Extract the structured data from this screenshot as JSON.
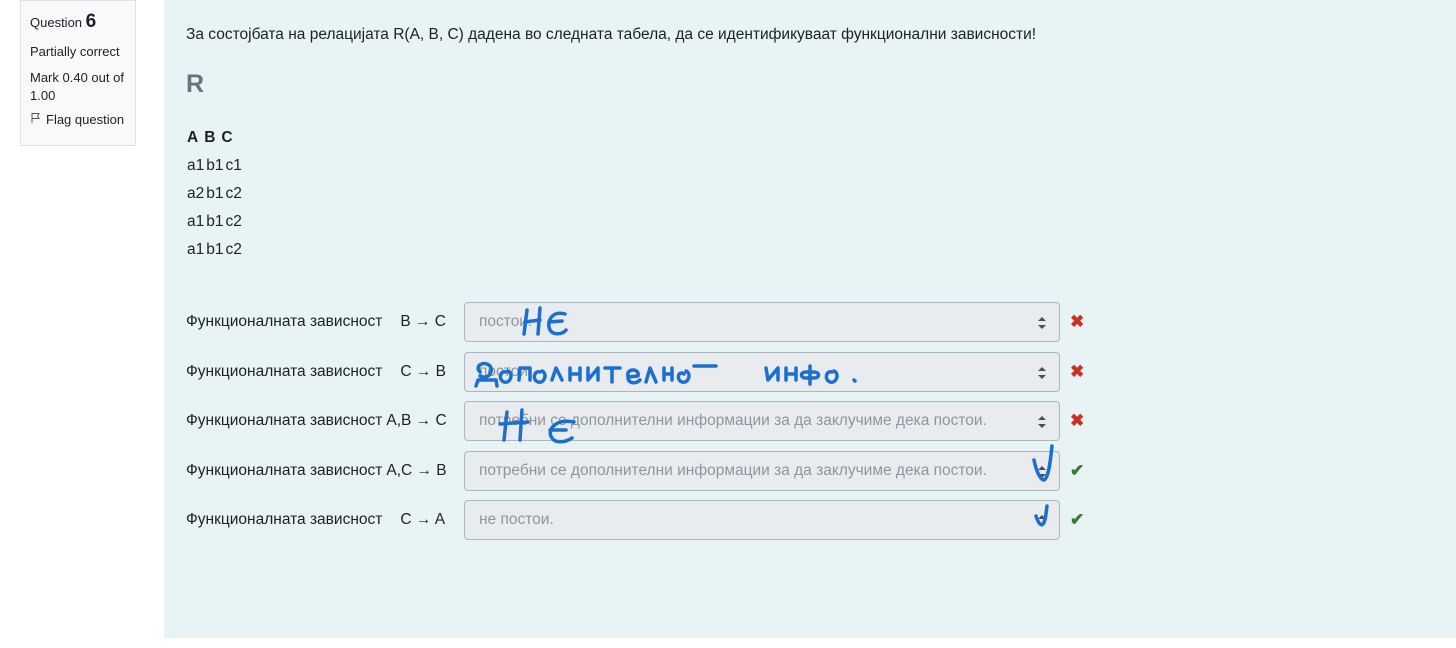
{
  "info": {
    "question_label": "Question",
    "question_number": "6",
    "state": "Partially correct",
    "grade": "Mark 0.40 out of 1.00",
    "flag_label": "Flag question"
  },
  "question": {
    "text": "За состојбата на релацијата R(A, B, C) дадена во следната табела, да се идентификуваат функционални зависности!",
    "relation_name": "R",
    "table": {
      "headers": [
        "A",
        "B",
        "C"
      ],
      "rows": [
        [
          "a1",
          "b1",
          "c1"
        ],
        [
          "a2",
          "b1",
          "c2"
        ],
        [
          "a1",
          "b1",
          "c2"
        ],
        [
          "a1",
          "b1",
          "c2"
        ]
      ]
    }
  },
  "answers": [
    {
      "label": "Функционалната зависност",
      "dependency": "B → C",
      "selected": "постои.",
      "result": "incorrect",
      "result_icon": "✖"
    },
    {
      "label": "Функционалната зависност",
      "dependency": "C → B",
      "selected": "постои.",
      "result": "incorrect",
      "result_icon": "✖"
    },
    {
      "label": "Функционалната зависност",
      "dependency": "A,B → C",
      "selected": "потребни се дополнителни информации за да заклучиме дека постои.",
      "result": "incorrect",
      "result_icon": "✖"
    },
    {
      "label": "Функционалната зависност",
      "dependency": "A,C → B",
      "selected": "потребни се дополнителни информации за да заклучиме дека постои.",
      "result": "correct",
      "result_icon": "✔"
    },
    {
      "label": "Функционалната зависност",
      "dependency": "C → A",
      "selected": "не постои.",
      "result": "correct",
      "result_icon": "✔"
    }
  ],
  "annotations": {
    "ink_color": "#1a6fd1",
    "notes": [
      "НЕ",
      "дополнително инфо.",
      "НЕ"
    ]
  },
  "colors": {
    "content_bg": "#e7f3f5",
    "incorrect": "#ca3120",
    "correct": "#357a32"
  }
}
